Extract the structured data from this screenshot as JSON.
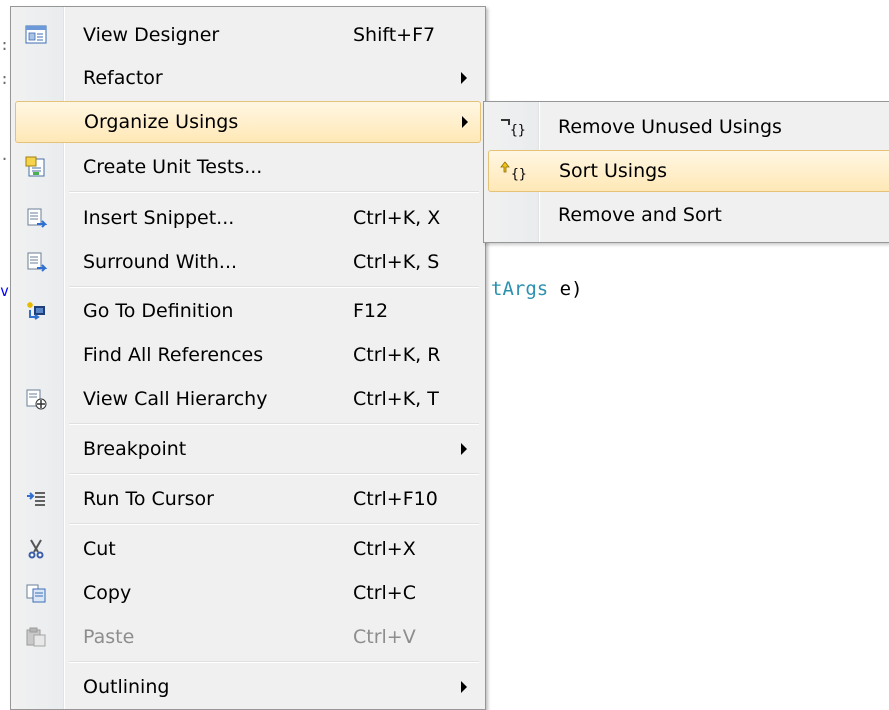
{
  "editor": {
    "code_fragment": "tArgs e)",
    "code_fragment_type": "tArgs",
    "code_fragment_rest": " e)"
  },
  "menu": {
    "items": [
      {
        "label": "View Designer",
        "shortcut": "Shift+F7",
        "icon": "view-designer-icon"
      },
      {
        "label": "Refactor",
        "shortcut": "",
        "icon": ""
      },
      {
        "label": "Organize Usings",
        "shortcut": "",
        "icon": ""
      },
      {
        "label": "Create Unit Tests...",
        "shortcut": "",
        "icon": "create-unit-tests-icon"
      },
      {
        "label": "Insert Snippet...",
        "shortcut": "Ctrl+K, X",
        "icon": "insert-snippet-icon"
      },
      {
        "label": "Surround With...",
        "shortcut": "Ctrl+K, S",
        "icon": "surround-with-icon"
      },
      {
        "label": "Go To Definition",
        "shortcut": "F12",
        "icon": "go-to-definition-icon"
      },
      {
        "label": "Find All References",
        "shortcut": "Ctrl+K, R",
        "icon": ""
      },
      {
        "label": "View Call Hierarchy",
        "shortcut": "Ctrl+K, T",
        "icon": "call-hierarchy-icon"
      },
      {
        "label": "Breakpoint",
        "shortcut": "",
        "icon": ""
      },
      {
        "label": "Run To Cursor",
        "shortcut": "Ctrl+F10",
        "icon": "run-to-cursor-icon"
      },
      {
        "label": "Cut",
        "shortcut": "Ctrl+X",
        "icon": "cut-icon"
      },
      {
        "label": "Copy",
        "shortcut": "Ctrl+C",
        "icon": "copy-icon"
      },
      {
        "label": "Paste",
        "shortcut": "Ctrl+V",
        "icon": "paste-icon"
      },
      {
        "label": "Outlining",
        "shortcut": "",
        "icon": ""
      }
    ],
    "highlighted_item": "Organize Usings",
    "disabled_item": "Paste"
  },
  "submenu": {
    "items": [
      {
        "label": "Remove Unused Usings",
        "icon": "remove-unused-usings-icon"
      },
      {
        "label": "Sort Usings",
        "icon": "sort-usings-icon"
      },
      {
        "label": "Remove and Sort",
        "icon": ""
      }
    ],
    "highlighted_item": "Sort Usings"
  },
  "colors": {
    "menu_background": "#f0f0f0",
    "highlight_top": "#fff7e3",
    "highlight_bottom": "#ffe8b6",
    "highlight_border": "#e6c278",
    "code_type_color": "#2b91af",
    "disabled_text": "#8d8d8d"
  }
}
